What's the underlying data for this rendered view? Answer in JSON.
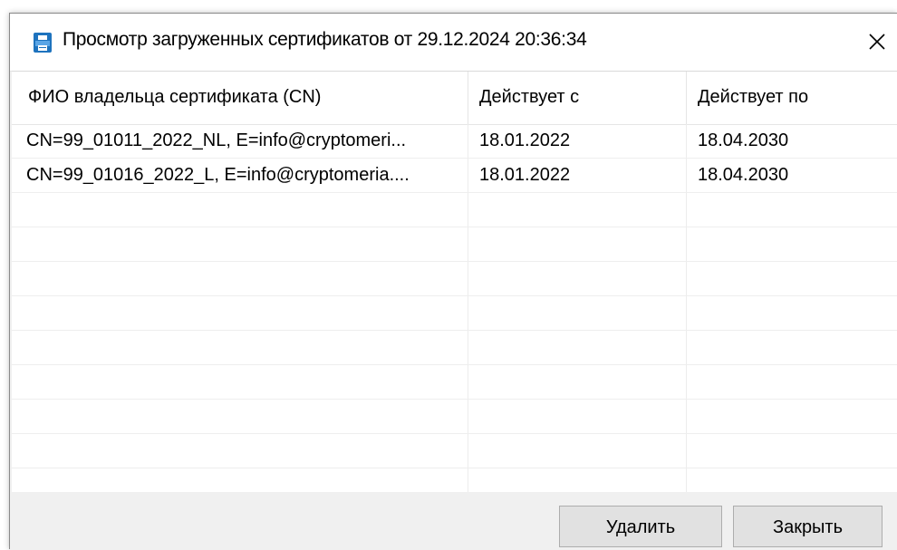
{
  "window": {
    "title": "Просмотр загруженных сертификатов от 29.12.2024 20:36:34",
    "icon": "printer-icon",
    "close_icon": "close-icon"
  },
  "table": {
    "columns": [
      "ФИО владельца сертификата (CN)",
      "Действует с",
      "Действует по"
    ],
    "rows": [
      [
        "CN=99_01011_2022_NL, E=info@cryptomeri...",
        "18.01.2022",
        "18.04.2030"
      ],
      [
        "CN=99_01016_2022_L, E=info@cryptomeria....",
        "18.01.2022",
        "18.04.2030"
      ]
    ]
  },
  "buttons": {
    "delete_label": "Удалить",
    "close_label": "Закрыть"
  },
  "colors": {
    "icon_blue": "#1e73be",
    "button_bg": "#e1e1e1",
    "button_border": "#adadad"
  }
}
